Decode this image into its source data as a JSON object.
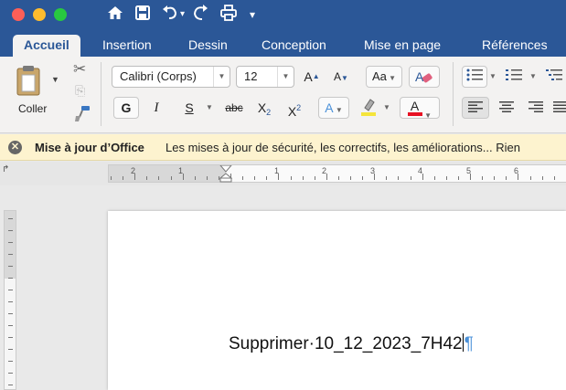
{
  "quick_access": {
    "icons": [
      "home-icon",
      "save-icon",
      "undo-icon",
      "redo-icon",
      "print-icon",
      "customize-icon"
    ],
    "undo_dropdown": "▾",
    "customize_symbol": "▾"
  },
  "tabs": [
    {
      "label": "Accueil",
      "active": true
    },
    {
      "label": "Insertion",
      "active": false
    },
    {
      "label": "Dessin",
      "active": false
    },
    {
      "label": "Conception",
      "active": false
    },
    {
      "label": "Mise en page",
      "active": false
    },
    {
      "label": "Références",
      "active": false
    }
  ],
  "ribbon": {
    "paste_label": "Coller",
    "font_name": "Calibri (Corps)",
    "font_size": "12",
    "grow_font": "A",
    "shrink_font": "A",
    "change_case": "Aa",
    "bold": "G",
    "italic": "I",
    "underline": "S",
    "strikethrough": "abc",
    "subscript": "X",
    "subscript_mark": "2",
    "superscript": "X",
    "superscript_mark": "2",
    "text_effects": "A",
    "font_color": "A",
    "highlight_color": "#f5e53b",
    "font_color_bar": "#e81123"
  },
  "notification": {
    "title": "Mise à jour d’Office",
    "message": "Les mises à jour de sécurité, les correctifs, les améliorations... Rien"
  },
  "ruler": {
    "left_numbers": [
      "2",
      "1"
    ],
    "right_numbers": [
      "1",
      "2",
      "3",
      "4",
      "5",
      "6"
    ]
  },
  "document": {
    "text": "Supprimer·10_12_2023_7H42",
    "pilcrow": "¶"
  },
  "colors": {
    "title_bar": "#2b5797",
    "notification_bg": "#fdf3cf"
  }
}
